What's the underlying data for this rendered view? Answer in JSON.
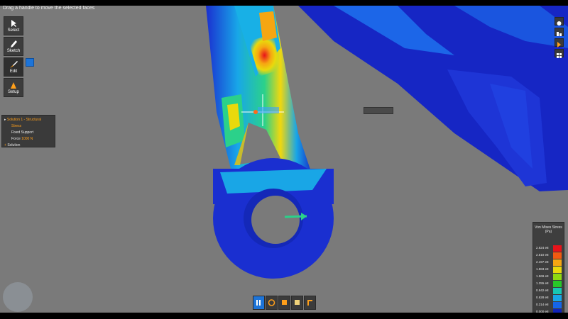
{
  "hint": "Drag a handle to move the selected faces",
  "toolbar": {
    "select": "Select",
    "sketch": "Sketch",
    "edit": "Edit",
    "setup": "Setup"
  },
  "tree": {
    "solution": "Solution 1 - Structural",
    "stress": "Stress",
    "fixed": "Fixed Support",
    "force_label": "Force",
    "force_value": "1000 N",
    "add_solution": "Solution"
  },
  "legend": {
    "title_line1": "Von Mises Stress",
    "title_line2": "(Pa)",
    "values": [
      "2.624 e8",
      "2.510 e8",
      "2.197 e8",
      "1.883 e8",
      "1.569 e8",
      "1.255 e8",
      "0.942 e8",
      "0.628 e8",
      "0.314 e8",
      "0.000 e8"
    ],
    "colors": [
      "#e8131a",
      "#f25a10",
      "#f6a612",
      "#e9d90c",
      "#8fda10",
      "#28c928",
      "#17c7b3",
      "#19a6e6",
      "#1565e9",
      "#1224b9"
    ]
  }
}
